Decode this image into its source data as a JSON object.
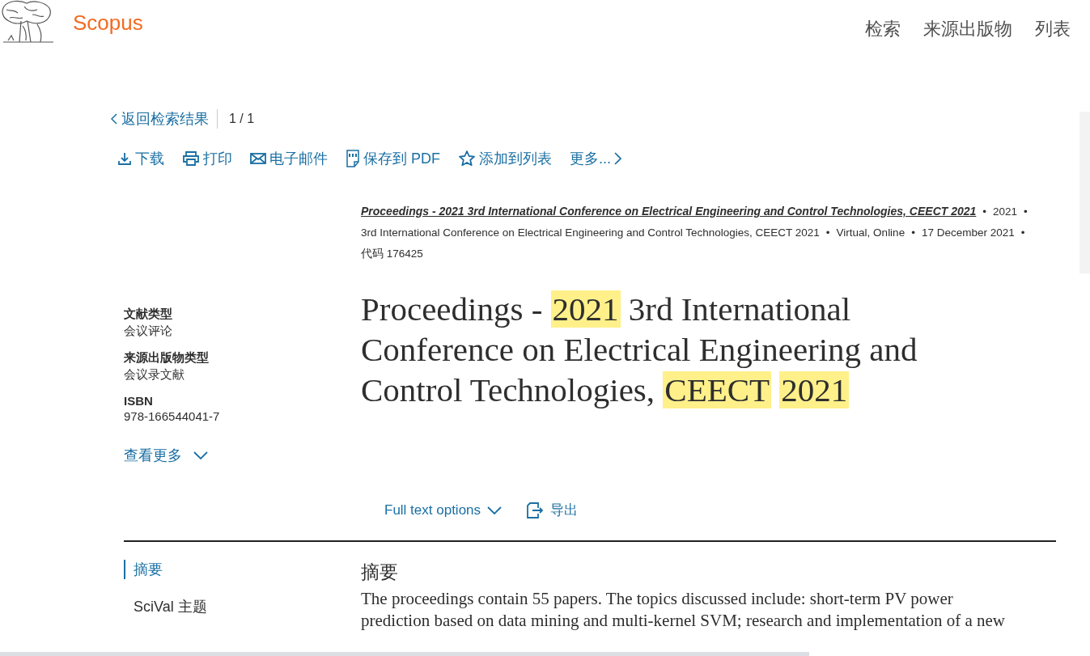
{
  "header": {
    "brand": "Scopus",
    "nav": [
      {
        "label": "检索"
      },
      {
        "label": "来源出版物"
      },
      {
        "label": "列表"
      }
    ]
  },
  "back": {
    "label": "返回检索结果",
    "pager": "1 / 1"
  },
  "toolbar": [
    {
      "kind": "download",
      "label": "下载"
    },
    {
      "kind": "print",
      "label": "打印"
    },
    {
      "kind": "email",
      "label": "电子邮件"
    },
    {
      "kind": "pdf",
      "label": "保存到 PDF"
    },
    {
      "kind": "star",
      "label": "添加到列表"
    },
    {
      "kind": "more",
      "label": "更多..."
    }
  ],
  "source": [
    {
      "kind": "link",
      "text": "Proceedings - 2021 3rd International Conference on Electrical Engineering and Control Technologies, CEECT 2021",
      "separator": "•"
    },
    {
      "kind": "detail",
      "text": "2021",
      "separator": "•"
    },
    {
      "kind": "detail",
      "text": "3rd International Conference on Electrical Engineering and Control Technologies, CEECT 2021",
      "separator": "•"
    },
    {
      "kind": "detail",
      "text": "Virtual, Online",
      "separator": "•"
    },
    {
      "kind": "detail",
      "text": "17 December 2021",
      "separator": "•"
    },
    {
      "kind": "detail",
      "text": "代码 176425"
    }
  ],
  "details": [
    {
      "label": "文献类型",
      "value": "会议评论"
    },
    {
      "label": "来源出版物类型",
      "value": "会议录文献"
    },
    {
      "label": "ISBN",
      "value": "978-166544041-7"
    }
  ],
  "show_more": "查看更多",
  "title": [
    {
      "text": "Proceedings - ",
      "highlighted": false
    },
    {
      "text": "2021",
      "highlighted": true
    },
    {
      "text": " 3rd International Conference on Electrical Engineering and Control Technologies, ",
      "highlighted": false
    },
    {
      "text": "CEECT",
      "highlighted": true
    },
    {
      "text": "2021",
      "highlighted": true
    }
  ],
  "actions": {
    "full_text": "Full text options",
    "export": "导出"
  },
  "section_nav": [
    {
      "label": "摘要",
      "selected": true
    },
    {
      "label": "SciVal 主题",
      "selected": false
    }
  ],
  "abstract": {
    "heading": "摘要",
    "text": "The proceedings contain 55 papers. The topics discussed include: short-term PV power prediction based on data mining and multi-kernel SVM; research and implementation of a new"
  }
}
